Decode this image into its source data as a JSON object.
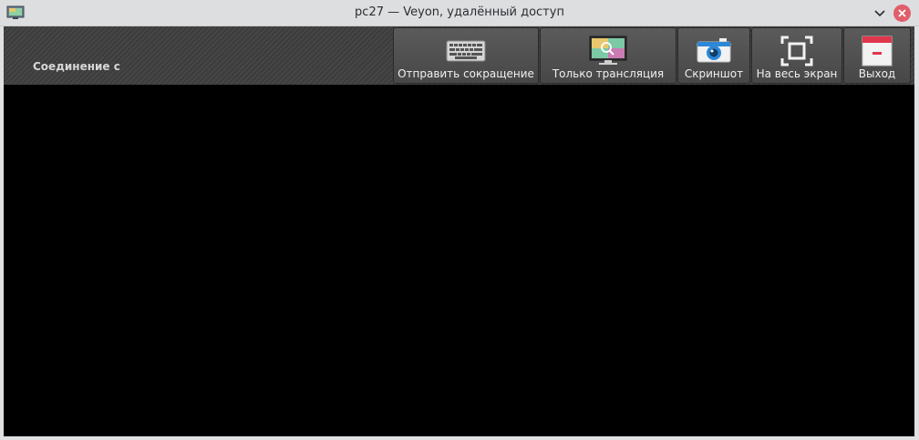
{
  "window": {
    "title": "pc27 — Veyon, удалённый доступ",
    "app_icon": "monitor-icon",
    "min_icon": "chevron-down-icon",
    "close_icon": "close-icon",
    "close_color": "#e05e6a"
  },
  "toolbar": {
    "connection_label": "Соединение с",
    "buttons": [
      {
        "label": "Отправить сокращение",
        "icon": "keyboard-icon"
      },
      {
        "label": "Только трансляция",
        "icon": "monitor-search-icon"
      },
      {
        "label": "Скриншот",
        "icon": "camera-icon"
      },
      {
        "label": "На весь экран",
        "icon": "fullscreen-icon"
      },
      {
        "label": "Выход",
        "icon": "exit-icon"
      }
    ]
  },
  "colors": {
    "toolbar_bg": "#3f3f3f",
    "remote_view_bg": "#000000",
    "exit_accent": "#e0364c"
  }
}
